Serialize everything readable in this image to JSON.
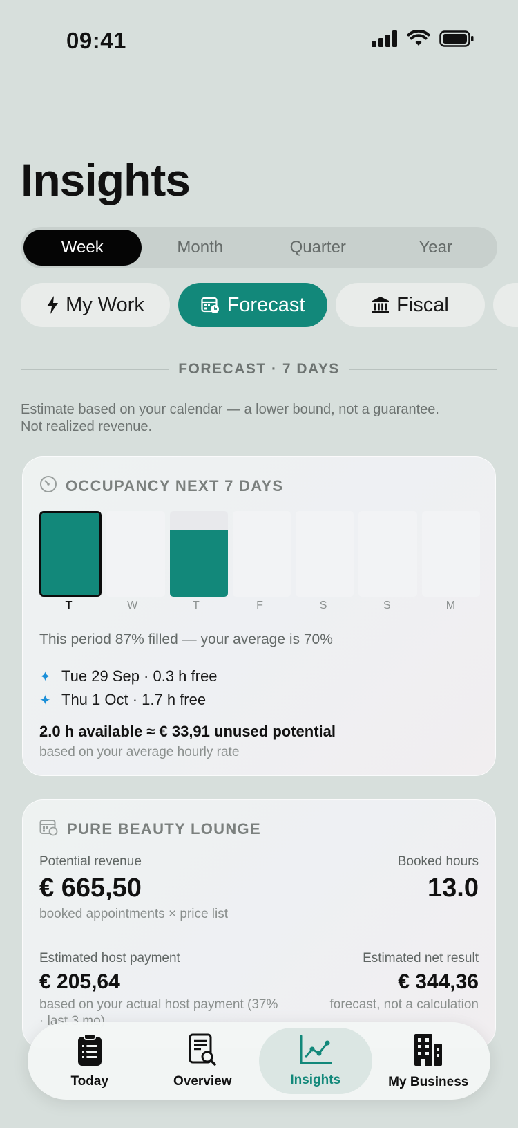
{
  "status": {
    "time": "09:41"
  },
  "page": {
    "title": "Insights"
  },
  "periods": [
    {
      "label": "Week",
      "active": true
    },
    {
      "label": "Month",
      "active": false
    },
    {
      "label": "Quarter",
      "active": false
    },
    {
      "label": "Year",
      "active": false
    }
  ],
  "chips": [
    {
      "label": "My Work",
      "icon": "bolt-icon",
      "active": false
    },
    {
      "label": "Forecast",
      "icon": "calendar-clock-icon",
      "active": true
    },
    {
      "label": "Fiscal",
      "icon": "bank-icon",
      "active": false
    }
  ],
  "section": {
    "label": "FORECAST · 7 DAYS",
    "disclaimer_line1": "Estimate based on your calendar — a lower bound, not a guarantee.",
    "disclaimer_line2": "Not realized revenue."
  },
  "occupancy": {
    "title": "OCCUPANCY NEXT 7 DAYS",
    "icon": "gauge-icon",
    "period_text": "This period 87% filled — your average is 70%",
    "free_slots": [
      {
        "text": "Tue 29 Sep · 0.3 h free",
        "icon": "sparkle-icon"
      },
      {
        "text": "Thu 1 Oct · 1.7 h free",
        "icon": "sparkle-icon"
      }
    ],
    "available": "2.0 h available ≈ € 33,91 unused potential",
    "available_sub": "based on your average hourly rate"
  },
  "chart_data": {
    "type": "bar",
    "categories": [
      "T",
      "W",
      "T",
      "F",
      "S",
      "S",
      "M"
    ],
    "values": [
      1.0,
      0,
      0.78,
      0,
      0,
      0,
      0
    ],
    "ylim": [
      0,
      1
    ],
    "selected_index": 0,
    "bar_color": "#12887a"
  },
  "business": {
    "title": "PURE BEAUTY LOUNGE",
    "icon": "calendar-grid-icon",
    "potential_revenue_label": "Potential revenue",
    "potential_revenue_value": "€ 665,50",
    "potential_revenue_sub": "booked appointments × price list",
    "booked_hours_label": "Booked hours",
    "booked_hours_value": "13.0",
    "host_payment_label": "Estimated host payment",
    "host_payment_value": "€ 205,64",
    "host_payment_sub": "based on your actual host payment (37% · last 3 mo)",
    "net_result_label": "Estimated net result",
    "net_result_value": "€ 344,36",
    "net_result_sub": "forecast, not a calculation"
  },
  "tabs": [
    {
      "label": "Today",
      "icon": "clipboard-list-icon",
      "active": false
    },
    {
      "label": "Overview",
      "icon": "document-search-icon",
      "active": false
    },
    {
      "label": "Insights",
      "icon": "line-chart-icon",
      "active": true
    },
    {
      "label": "My Business",
      "icon": "building-icon",
      "active": false
    }
  ],
  "colors": {
    "accent": "#12887a",
    "sparkle": "#1a8fd8",
    "background": "#d7dfdc"
  }
}
